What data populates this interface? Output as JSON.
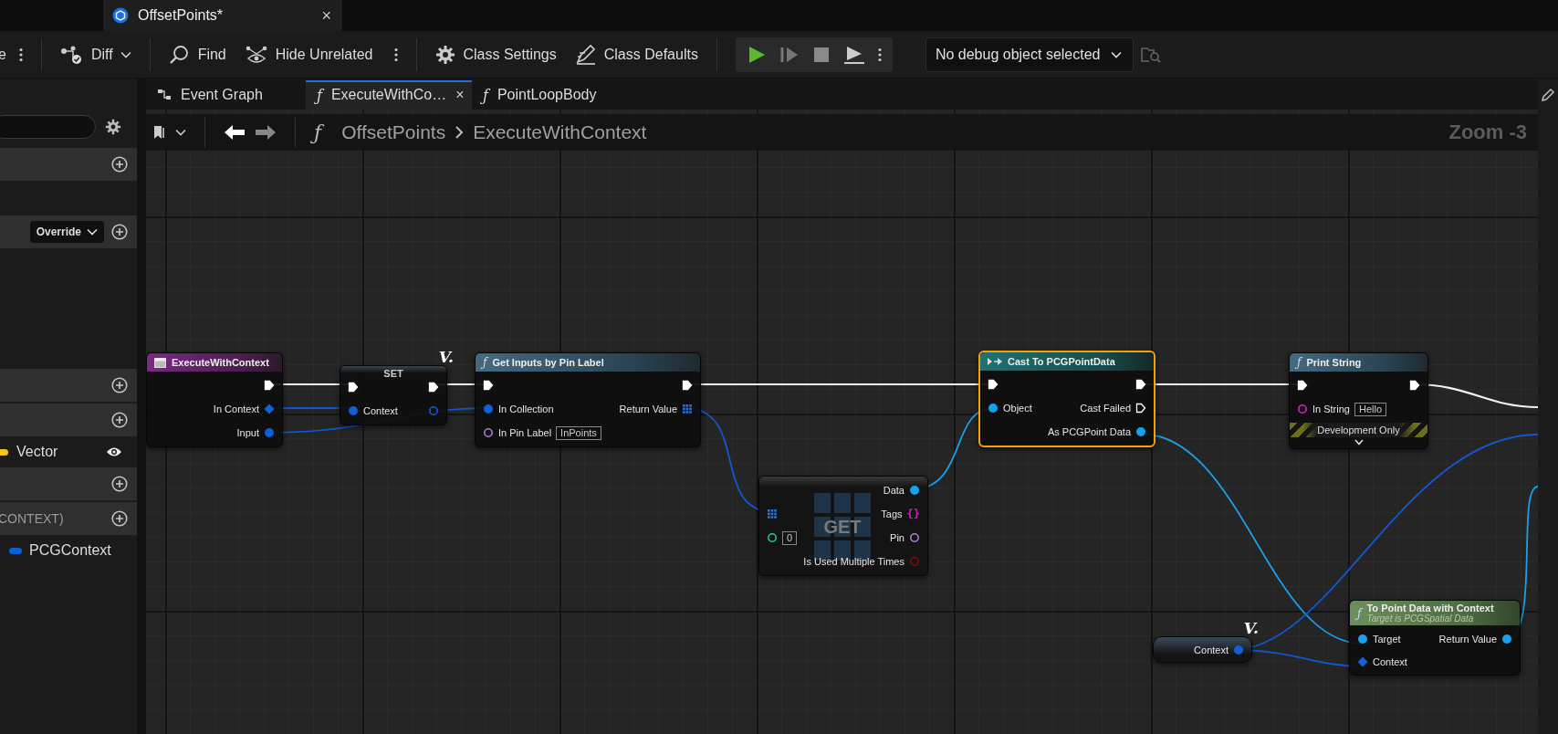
{
  "document_tab": {
    "title": "OffsetPoints*",
    "close": "×"
  },
  "toolbar": {
    "cut_label": "e",
    "diff": "Diff",
    "find": "Find",
    "hide_unrelated": "Hide Unrelated",
    "class_settings": "Class Settings",
    "class_defaults": "Class Defaults",
    "debug_object": "No debug object selected"
  },
  "graph_tabs": [
    {
      "kind": "graph",
      "label": "Event Graph",
      "selected": false
    },
    {
      "kind": "function",
      "icon": "ƒ",
      "label": "ExecuteWithCo…",
      "close": "×",
      "selected": true
    },
    {
      "kind": "function",
      "icon": "ƒ",
      "label": "PointLoopBody",
      "selected": false
    }
  ],
  "breadcrumb": {
    "icon": "ƒ",
    "path": [
      "OffsetPoints",
      "ExecuteWithContext"
    ],
    "zoom": "Zoom -3"
  },
  "sidebar": {
    "rows": [
      {
        "kind": "header"
      },
      {
        "kind": "header",
        "dropdown": "Override"
      },
      {
        "kind": "header"
      },
      {
        "kind": "header"
      },
      {
        "kind": "variable",
        "label": "Vector",
        "color": "#f5c518",
        "visible": true
      },
      {
        "kind": "header"
      },
      {
        "kind": "header",
        "label": "CONTEXT)"
      },
      {
        "kind": "variable",
        "label": "PCGContext",
        "color": "#0b5fd6",
        "visible": false
      }
    ]
  },
  "nodes": [
    {
      "kind": "event",
      "title": "ExecuteWithContext",
      "selected": false,
      "outputs": [
        {
          "kind": "exec",
          "linked": true
        },
        {
          "kind": "struct",
          "label": "In Context",
          "linked": true
        },
        {
          "kind": "ref",
          "label": "Input",
          "linked": true
        }
      ]
    },
    {
      "kind": "set",
      "title": "SET",
      "badge": "V.",
      "selected": false,
      "inputs": [
        {
          "kind": "exec",
          "linked": true
        },
        {
          "kind": "ref",
          "label": "Context",
          "linked": true
        }
      ],
      "outputs": [
        {
          "kind": "exec",
          "linked": true
        },
        {
          "kind": "ref",
          "linked": false
        }
      ]
    },
    {
      "kind": "function",
      "icon": "ƒ",
      "title": "Get Inputs by Pin Label",
      "selected": false,
      "inputs": [
        {
          "kind": "exec",
          "linked": true
        },
        {
          "kind": "ref",
          "label": "In Collection",
          "linked": true
        },
        {
          "kind": "name",
          "label": "In Pin Label",
          "linked": false,
          "value": "InPoints"
        }
      ],
      "outputs": [
        {
          "kind": "exec",
          "linked": true
        },
        {
          "kind": "array",
          "label": "Return Value",
          "linked": true
        }
      ]
    },
    {
      "kind": "get",
      "title": "GET",
      "selected": false,
      "inputs": [
        {
          "kind": "array",
          "linked": true
        },
        {
          "kind": "int",
          "linked": false,
          "value": "0"
        }
      ],
      "outputs": [
        {
          "kind": "object",
          "label": "Data",
          "linked": true
        },
        {
          "kind": "set",
          "label": "Tags",
          "glyph": "{}",
          "linked": false
        },
        {
          "kind": "pin",
          "label": "Pin",
          "linked": false
        },
        {
          "kind": "bool",
          "label": "Is Used Multiple Times",
          "linked": false
        }
      ]
    },
    {
      "kind": "cast",
      "title": "Cast To PCGPointData",
      "selected": true,
      "inputs": [
        {
          "kind": "exec",
          "linked": true
        },
        {
          "kind": "object",
          "label": "Object",
          "linked": true
        }
      ],
      "outputs": [
        {
          "kind": "exec",
          "linked": true
        },
        {
          "kind": "exec",
          "label": "Cast Failed",
          "linked": false
        },
        {
          "kind": "object",
          "label": "As PCGPoint Data",
          "linked": true
        }
      ]
    },
    {
      "kind": "function",
      "icon": "ƒ",
      "title": "Print String",
      "footer": "Development Only",
      "selected": false,
      "inputs": [
        {
          "kind": "exec",
          "linked": true
        },
        {
          "kind": "string",
          "label": "In String",
          "linked": false,
          "value": "Hello"
        }
      ],
      "outputs": [
        {
          "kind": "exec",
          "linked": true
        }
      ]
    },
    {
      "kind": "getter",
      "badge": "V.",
      "selected": false,
      "outputs": [
        {
          "kind": "ref",
          "label": "Context",
          "linked": true
        }
      ]
    },
    {
      "kind": "pure_function",
      "icon": "ƒ",
      "title": "To Point Data with Context",
      "subtitle": "Target is PCGSpatial Data",
      "selected": false,
      "inputs": [
        {
          "kind": "object",
          "label": "Target",
          "linked": true
        },
        {
          "kind": "struct",
          "label": "Context",
          "linked": true
        }
      ],
      "outputs": [
        {
          "kind": "object",
          "label": "Return Value",
          "linked": true
        }
      ]
    }
  ]
}
